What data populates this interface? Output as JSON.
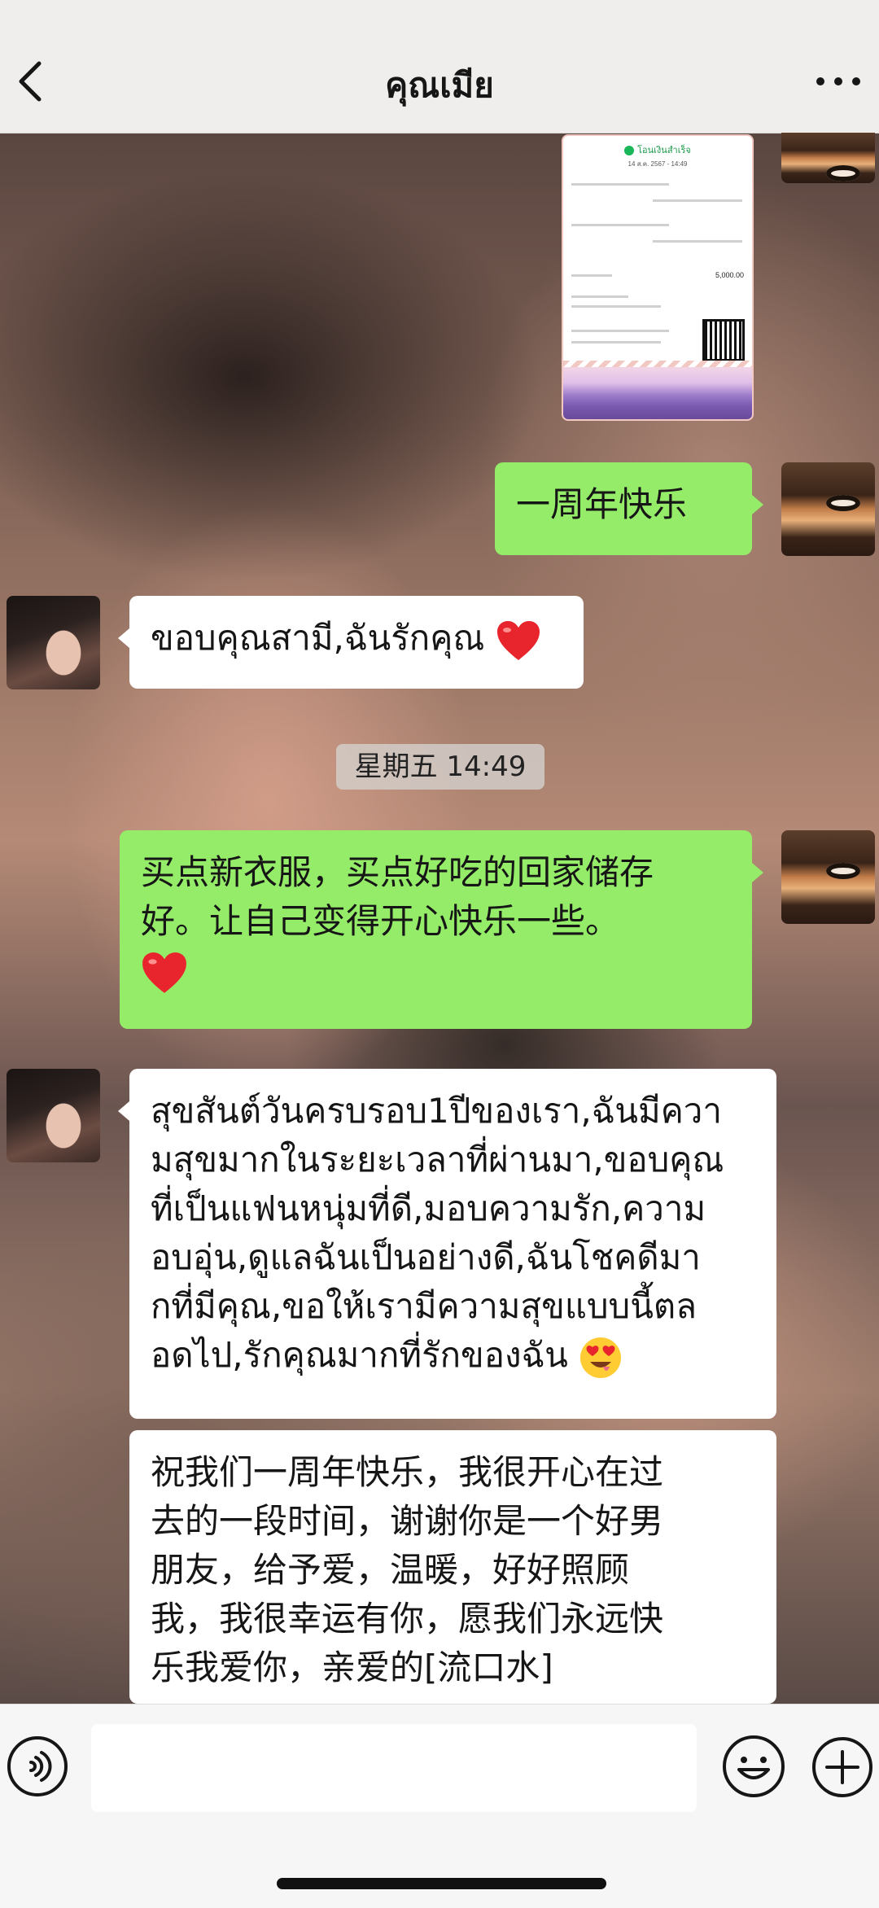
{
  "header": {
    "title": "คุณเมีย",
    "back_icon": "chevron-left-icon",
    "more_icon": "more-dots-icon"
  },
  "receipt": {
    "status": "โอนเงินสำเร็จ",
    "date": "14 ส.ค. 2567 - 14:49",
    "amount": "5,000.00"
  },
  "messages": [
    {
      "side": "me",
      "text": "一周年快乐"
    },
    {
      "side": "her",
      "text": "ขอบคุณสามี,ฉันรักคุณ",
      "emoji": "heart-emoji"
    },
    {
      "side": "system",
      "text": "星期五 14:49"
    },
    {
      "side": "me",
      "lines": [
        "买点新衣服，买点好吃的回家储存",
        "好。让自己变得开心快乐一些。"
      ],
      "emoji": "heart-emoji"
    },
    {
      "side": "her",
      "lines": [
        "สุขสันต์วันครบรอบ1ปีของเรา,ฉันมีควา",
        "มสุขมากในระยะเวลาที่ผ่านมา,ขอบคุณ",
        "ที่เป็นแฟนหนุ่มที่ดี,มอบความรัก,ความ",
        "อบอุ่น,ดูแลฉันเป็นอย่างดี,ฉันโชคดีมา",
        "กที่มีคุณ,ขอให้เรามีความสุขแบบนี้ตล",
        "อดไป,รักคุณมากที่รักของฉัน"
      ],
      "emoji": "heart-eyes-emoji"
    },
    {
      "side": "her",
      "lines": [
        "祝我们一周年快乐，我很开心在过",
        "去的一段时间，谢谢你是一个好男",
        "朋友，给予爱，温暖，好好照顾",
        "我，我很幸运有你，愿我们永远快",
        "乐我爱你，亲爱的[流口水]"
      ]
    }
  ],
  "input_bar": {
    "voice_icon": "voice-icon",
    "text_value": "",
    "emoji_icon": "emoji-icon",
    "plus_icon": "plus-icon"
  },
  "colors": {
    "my_bubble": "#95ec69",
    "their_bubble": "#ffffff",
    "header_bg": "#efeeec",
    "input_bg": "#f6f6f6"
  }
}
